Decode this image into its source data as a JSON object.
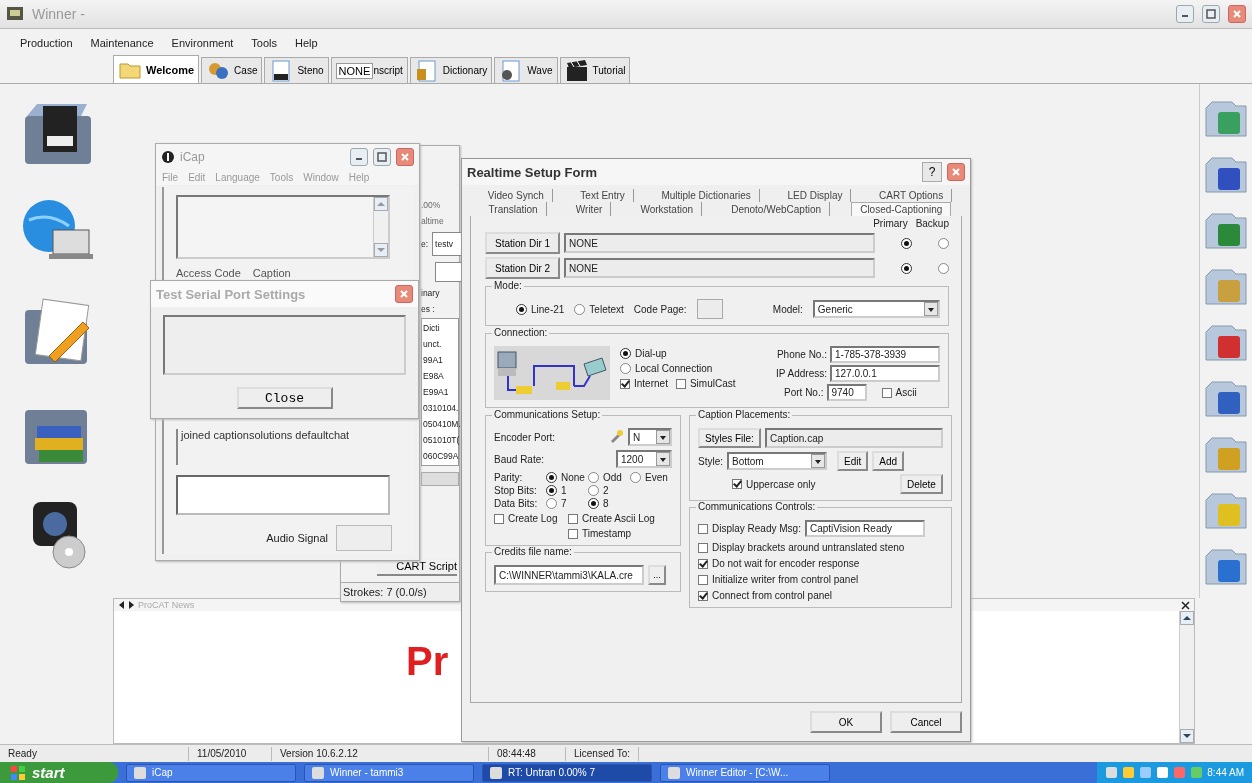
{
  "main_window": {
    "title": "Winner -"
  },
  "menu": [
    "Production",
    "Maintenance",
    "Environment",
    "Tools",
    "Help"
  ],
  "tabs": [
    {
      "label": "Welcome",
      "selected": true
    },
    {
      "label": "Case",
      "selected": false
    },
    {
      "label": "Steno",
      "selected": false
    },
    {
      "label": "NONE",
      "extra": "nscript",
      "selected": false
    },
    {
      "label": "Dictionary",
      "selected": false
    },
    {
      "label": "Wave",
      "selected": false
    },
    {
      "label": "Tutorial",
      "selected": false
    }
  ],
  "rt_window": {
    "percent": ".00%",
    "mode": "altime",
    "field_label": "e:",
    "field_value": "testv",
    "label_2": "inary",
    "label_3": "es :",
    "items": [
      "Dicti",
      "unct.",
      "99A1",
      "E98A",
      "E99A1",
      "0310104.",
      "050410M.",
      "051010T(",
      "060C99A"
    ],
    "button": "CART Script",
    "strokes": "Strokes: 7  (0.0/s)"
  },
  "icap": {
    "title": "iCap",
    "menu": [
      "File",
      "Edit",
      "Language",
      "Tools",
      "Window",
      "Help"
    ],
    "groups": [
      "Access Code",
      "Caption"
    ],
    "message": "joined captionsolutions defaultchat",
    "audio_label": "Audio Signal"
  },
  "serial_dialog": {
    "title": "Test Serial Port Settings",
    "button": "Close"
  },
  "realtime_form": {
    "title": "Realtime Setup Form",
    "help": "?",
    "tab_rows": [
      [
        {
          "label": "Video Synch",
          "selected": false
        },
        {
          "label": "Text Entry",
          "selected": false
        },
        {
          "label": "Multiple Dictionaries",
          "selected": false
        },
        {
          "label": "LED Display",
          "selected": false
        },
        {
          "label": "CART Options",
          "selected": false
        }
      ],
      [
        {
          "label": "Translation",
          "selected": false
        },
        {
          "label": "Writer",
          "selected": false
        },
        {
          "label": "Workstation",
          "selected": false
        },
        {
          "label": "Denoto/WebCaption",
          "selected": false
        },
        {
          "label": "Closed-Captioning",
          "selected": true
        }
      ]
    ],
    "column_headers": [
      "Primary",
      "Backup"
    ],
    "stations": [
      {
        "button": "Station Dir 1",
        "value": "NONE",
        "primary": true,
        "backup": false
      },
      {
        "button": "Station Dir 2",
        "value": "NONE",
        "primary": true,
        "backup": false
      }
    ],
    "mode": {
      "label": "Mode:",
      "options": [
        {
          "label": "Line-21",
          "selected": true
        },
        {
          "label": "Teletext",
          "selected": false
        }
      ],
      "code_page_label": "Code Page:",
      "model_label": "Model:",
      "model": "Generic"
    },
    "connection": {
      "label": "Connection:",
      "options": [
        {
          "label": "Dial-up",
          "selected": true
        },
        {
          "label": "Local Connection",
          "selected": false
        }
      ],
      "checks": [
        {
          "label": "Internet",
          "checked": true
        },
        {
          "label": "SimulCast",
          "checked": false
        }
      ],
      "phone_label": "Phone No.:",
      "phone": "1-785-378-3939",
      "ip_label": "IP Address:",
      "ip": "127.0.0.1",
      "port_label": "Port No.:",
      "port": "9740",
      "ascii": {
        "label": "Ascii",
        "checked": false
      }
    },
    "comm_setup": {
      "label": "Communications Setup:",
      "encoder_label": "Encoder Port:",
      "encoder": "N",
      "baud_label": "Baud Rate:",
      "baud": "1200",
      "radio_rows": [
        {
          "label": "Parity:",
          "options": [
            {
              "label": "None",
              "selected": true
            },
            {
              "label": "Odd",
              "selected": false
            },
            {
              "label": "Even",
              "selected": false
            }
          ]
        },
        {
          "label": "Stop Bits:",
          "options": [
            {
              "label": "1",
              "selected": true
            },
            {
              "label": "2",
              "selected": false
            }
          ]
        },
        {
          "label": "Data Bits:",
          "options": [
            {
              "label": "7",
              "selected": false
            },
            {
              "label": "8",
              "selected": true
            }
          ]
        }
      ],
      "checks": [
        {
          "label": "Create Log",
          "checked": false
        },
        {
          "label": "Create Ascii Log",
          "checked": false
        },
        {
          "label": "Timestamp",
          "checked": false
        }
      ]
    },
    "credits": {
      "label": "Credits file name:",
      "value": "C:\\WINNER\\tammi3\\KALA.cre",
      "browse": "..."
    },
    "caption_placements": {
      "label": "Caption Placements:",
      "styles_button": "Styles File:",
      "styles_file": "Caption.cap",
      "style_label": "Style:",
      "style": "Bottom",
      "buttons": [
        "Edit",
        "Add",
        "Delete"
      ],
      "uppercase": {
        "label": "Uppercase only",
        "checked": true
      }
    },
    "comm_controls": {
      "label": "Communications Controls:",
      "items": [
        {
          "kind": "field",
          "label": "Display Ready Msg:",
          "checked": false,
          "value": "CaptiVision Ready"
        },
        {
          "kind": "check",
          "label": "Display brackets around untranslated steno",
          "checked": false
        },
        {
          "kind": "check",
          "label": "Do not wait for encoder response",
          "checked": true
        },
        {
          "kind": "check",
          "label": "Initialize writer from control panel",
          "checked": false
        },
        {
          "kind": "check",
          "label": "Connect from control panel",
          "checked": true
        }
      ]
    },
    "buttons": [
      "OK",
      "Cancel"
    ]
  },
  "news": {
    "title": "ProCAT News",
    "headline": "Pr"
  },
  "status_bar": [
    "Ready",
    "11/05/2010",
    "Version 10.6.2.12",
    "08:44:48",
    "Licensed To:"
  ],
  "taskbar": {
    "start": "start",
    "items": [
      {
        "label": "iCap",
        "selected": false
      },
      {
        "label": "Winner - tammi3",
        "selected": false
      },
      {
        "label": "RT: Untran 0.00%  7",
        "selected": true
      },
      {
        "label": "Winner Editor - [C:\\W...",
        "selected": false
      }
    ],
    "clock": "8:44 AM"
  }
}
